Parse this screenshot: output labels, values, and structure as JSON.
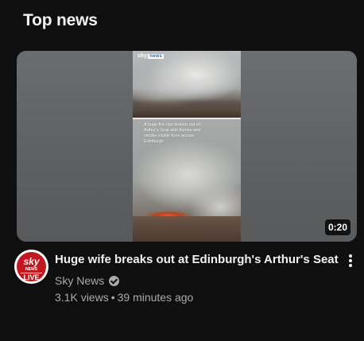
{
  "section": {
    "title": "Top news"
  },
  "video": {
    "duration": "0:20",
    "title": "Huge wife breaks out at Edinburgh's Arthur's Seat",
    "channel": "Sky News",
    "views": "3.1K views",
    "separator": "•",
    "age": "39 minutes ago",
    "overlay": {
      "logo_sky": "sky",
      "logo_news": "news",
      "caption": "A huge fire has broken out on Arthur's Seat with flames and smoke visible from across Edinburgh"
    }
  },
  "avatar": {
    "sky": "sky",
    "news": "NEWS",
    "live": "LIVE"
  },
  "colors": {
    "background": "#0f0f0f",
    "text_primary": "#f1f1f1",
    "text_secondary": "#aaaaaa",
    "sky_red": "#c4161c"
  },
  "icons": {
    "menu": "more-vert-icon",
    "verified": "verified-check-icon"
  }
}
